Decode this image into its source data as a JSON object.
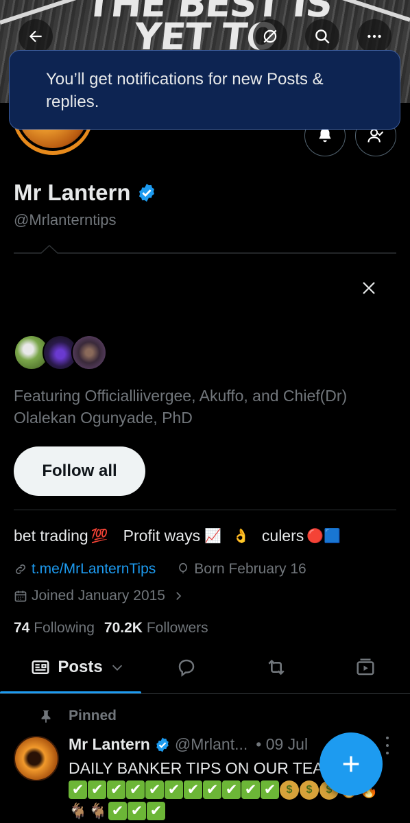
{
  "banner": {
    "text": "THE BEST IS YET TO COME"
  },
  "toast": {
    "message": "You’ll get notifications for new Posts & replies."
  },
  "profile": {
    "name": "Mr Lantern",
    "handle": "@Mrlanterntips",
    "verified_color": "#1d9bf0"
  },
  "suggestions": {
    "featuring": "Featuring Officialliivergee, Akuffo, and Chief(Dr) Olalekan Ogunyade, PhD",
    "follow_all_label": "Follow all"
  },
  "bio": {
    "part1": "bet trading",
    "hundred": "💯",
    "part2": "Profit ways",
    "chart": "📈",
    "ok": "👌",
    "part3": "culers",
    "red": "🔴",
    "blue": "🟦"
  },
  "meta": {
    "link": "t.me/MrLanternTips",
    "birthday": "Born February 16",
    "joined": "Joined January 2015"
  },
  "counts": {
    "following_num": "74",
    "following_label": "Following",
    "followers_num": "70.2K",
    "followers_label": "Followers"
  },
  "tabs": {
    "posts_label": "Posts"
  },
  "pinned_tweet": {
    "pinned_label": "Pinned",
    "name": "Mr Lantern",
    "handle": "@Mrlant...",
    "date": "• 09 Jul",
    "text": "DAILY BANKER TIPS ON OUR TEAM",
    "money_glyph": "$",
    "check_glyph": "✔",
    "goat_glyph": "🐐",
    "fire_glyph": "🔥"
  },
  "colors": {
    "background": "#000000",
    "accent": "#1d9bf0",
    "muted": "#71767b",
    "toast_bg": "#0d2452"
  }
}
